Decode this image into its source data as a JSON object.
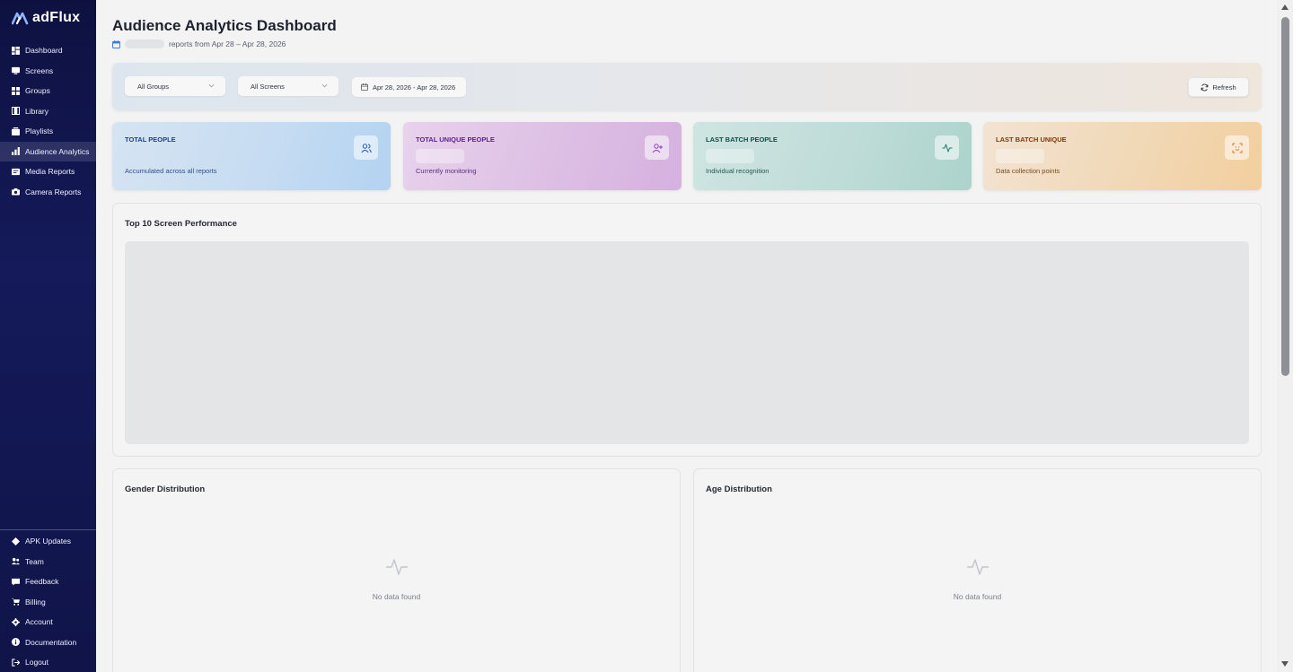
{
  "brand": {
    "name": "adFlux"
  },
  "nav": {
    "top": [
      {
        "label": "Dashboard",
        "icon": "dashboard-icon"
      },
      {
        "label": "Screens",
        "icon": "monitor-icon"
      },
      {
        "label": "Groups",
        "icon": "grid-icon"
      },
      {
        "label": "Library",
        "icon": "film-icon"
      },
      {
        "label": "Playlists",
        "icon": "playlist-icon"
      },
      {
        "label": "Audience Analytics",
        "icon": "bar-chart-icon",
        "active": true
      },
      {
        "label": "Media Reports",
        "icon": "media-report-icon"
      },
      {
        "label": "Camera Reports",
        "icon": "camera-icon"
      }
    ],
    "bottom": [
      {
        "label": "APK Updates",
        "icon": "android-icon"
      },
      {
        "label": "Team",
        "icon": "team-icon"
      },
      {
        "label": "Feedback",
        "icon": "feedback-icon"
      },
      {
        "label": "Billing",
        "icon": "cart-icon"
      },
      {
        "label": "Account",
        "icon": "gear-icon"
      },
      {
        "label": "Documentation",
        "icon": "info-icon"
      },
      {
        "label": "Logout",
        "icon": "logout-icon"
      }
    ]
  },
  "header": {
    "title": "Audience Analytics Dashboard",
    "subtitle": "reports from Apr 28 – Apr 28, 2026"
  },
  "filters": {
    "groups": "All Groups",
    "screens": "All Screens",
    "date_range": "Apr 28, 2026 - Apr 28, 2026",
    "refresh": "Refresh"
  },
  "stats": [
    {
      "label": "TOTAL PEOPLE",
      "desc": "Accumulated across all reports",
      "color": "#1f3f8a",
      "icon": "users-icon"
    },
    {
      "label": "TOTAL UNIQUE PEOPLE",
      "desc": "Currently monitoring",
      "color": "#5b2386",
      "icon": "user-plus-icon"
    },
    {
      "label": "LAST BATCH PEOPLE",
      "desc": "Individual recognition",
      "color": "#0f4f46",
      "icon": "activity-icon"
    },
    {
      "label": "LAST BATCH UNIQUE",
      "desc": "Data collection points",
      "color": "#7a3a0c",
      "icon": "face-scan-icon"
    }
  ],
  "panels": {
    "top_screens": "Top 10 Screen Performance",
    "gender": "Gender Distribution",
    "age": "Age Distribution",
    "no_data": "No data found"
  }
}
